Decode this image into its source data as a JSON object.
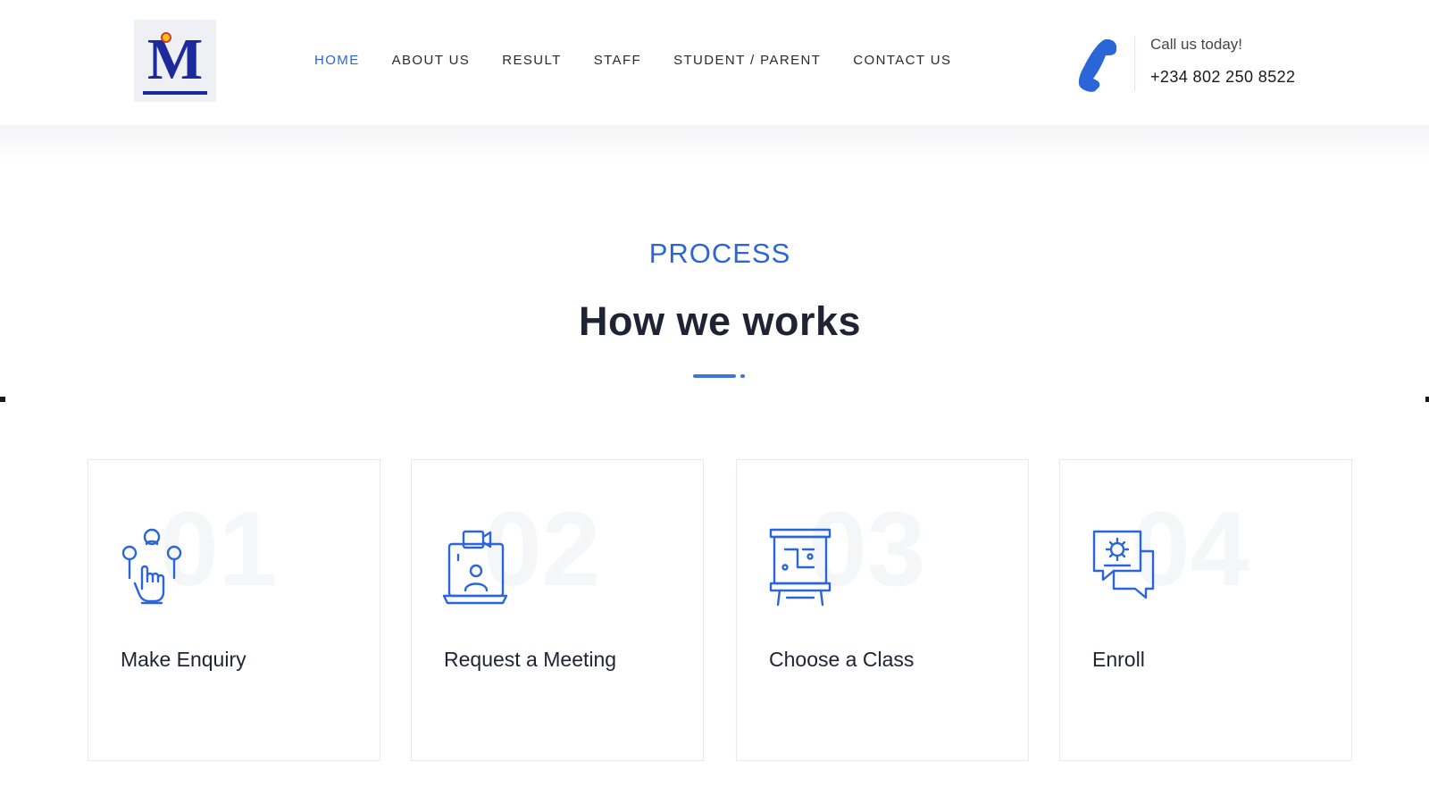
{
  "logo": {
    "letter": "M"
  },
  "nav": {
    "items": [
      {
        "label": "HOME",
        "active": true
      },
      {
        "label": "ABOUT US",
        "active": false
      },
      {
        "label": "RESULT",
        "active": false
      },
      {
        "label": "STAFF",
        "active": false
      },
      {
        "label": "STUDENT / PARENT",
        "active": false
      },
      {
        "label": "CONTACT US",
        "active": false
      }
    ]
  },
  "contact": {
    "icon": "phone-icon",
    "label": "Call us today!",
    "number": "+234 802 250 8522"
  },
  "section": {
    "eyebrow": "PROCESS",
    "title": "How we works"
  },
  "steps": [
    {
      "number": "01",
      "icon": "enquiry-icon",
      "label": "Make Enquiry"
    },
    {
      "number": "02",
      "icon": "meeting-icon",
      "label": "Request a Meeting"
    },
    {
      "number": "03",
      "icon": "class-board-icon",
      "label": "Choose a Class"
    },
    {
      "number": "04",
      "icon": "enroll-chat-icon",
      "label": "Enroll"
    }
  ],
  "colors": {
    "accent": "#2a66d8",
    "heading": "#1e2433",
    "card_border": "#e7e9ee"
  }
}
